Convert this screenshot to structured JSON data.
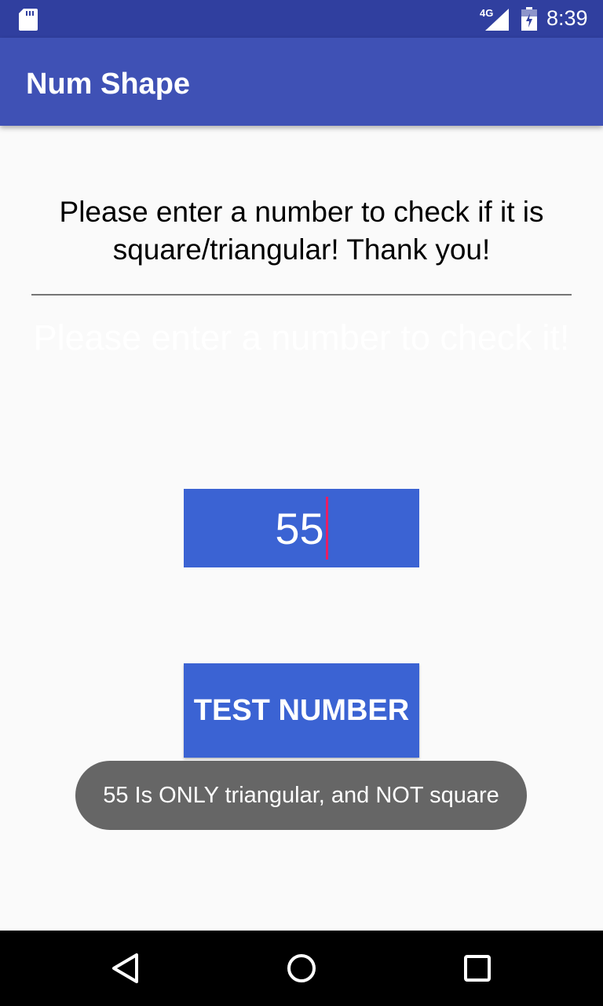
{
  "status_bar": {
    "network_type": "4G",
    "time": "8:39",
    "icons": [
      "sd-card-icon",
      "signal-icon",
      "battery-icon"
    ]
  },
  "app_bar": {
    "title": "Num Shape"
  },
  "main": {
    "prompt": "Please enter a number to check if it is square/triangular! Thank you!",
    "hint": "Please enter a number to check it!",
    "input_value": "55",
    "test_button_label": "TEST NUMBER"
  },
  "toast": {
    "message": "55 Is ONLY triangular, and NOT square"
  },
  "nav_bar": {
    "icons": [
      "back-icon",
      "home-icon",
      "recents-icon"
    ]
  },
  "colors": {
    "status_bar": "#303f9f",
    "app_bar": "#3f51b5",
    "accent_blue": "#3b63d3",
    "cursor": "#e91e63",
    "toast": "#666666"
  }
}
